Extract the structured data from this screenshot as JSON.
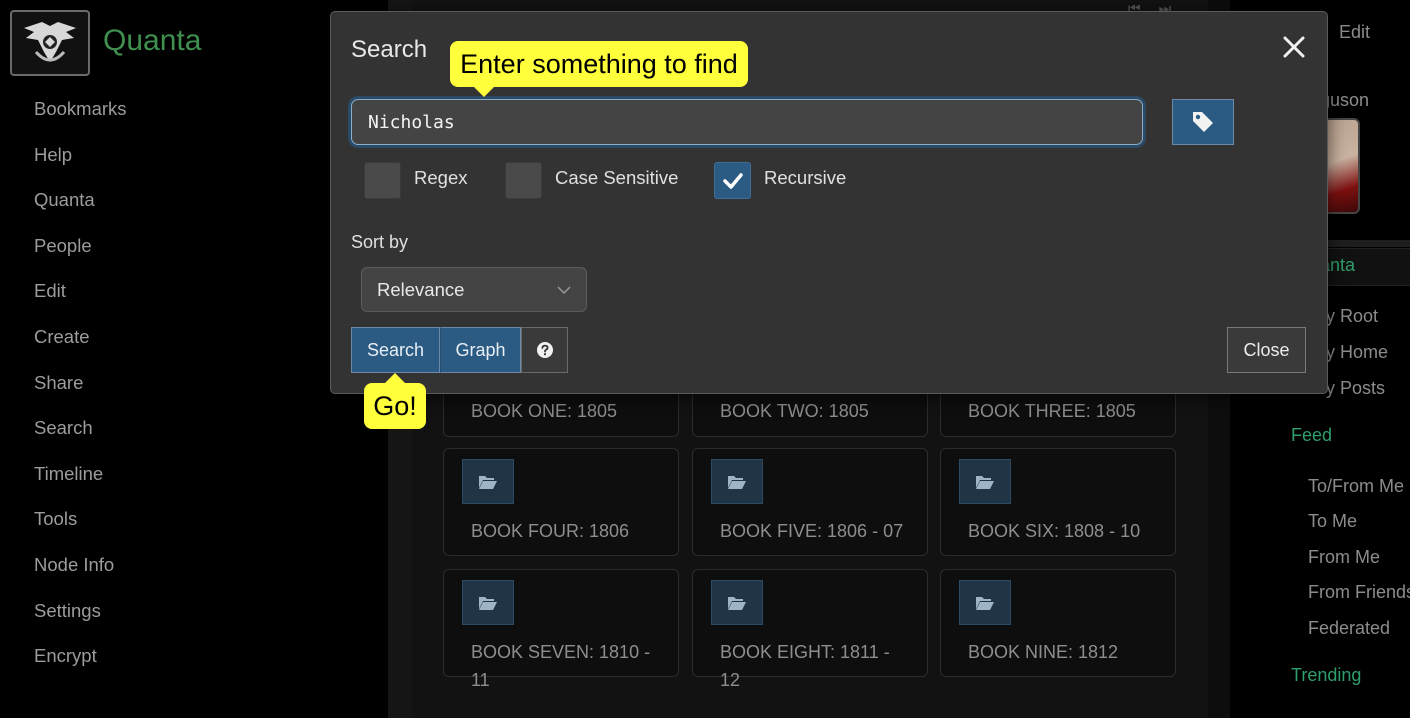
{
  "app": {
    "title": "Quanta"
  },
  "left_menu": [
    "Bookmarks",
    "Help",
    "Quanta",
    "People",
    "Edit",
    "Create",
    "Share",
    "Search",
    "Timeline",
    "Tools",
    "Node Info",
    "Settings",
    "Encrypt"
  ],
  "cards": [
    {
      "label": "BOOK ONE: 1805"
    },
    {
      "label": "BOOK TWO: 1805"
    },
    {
      "label": "BOOK THREE: 1805"
    },
    {
      "label": "BOOK FOUR: 1806"
    },
    {
      "label": "BOOK FIVE: 1806 - 07"
    },
    {
      "label": "BOOK SIX: 1808 - 10"
    },
    {
      "label": "BOOK SEVEN: 1810 - 11"
    },
    {
      "label": "BOOK EIGHT: 1811 - 12"
    },
    {
      "label": "BOOK NINE: 1812"
    }
  ],
  "right_panel": {
    "edit_label": "Edit",
    "user_name_fragment": "guson",
    "quanta_label": "anta",
    "links_top": [
      "y Root",
      "y Home",
      "y Posts"
    ],
    "feed_heading": "Feed",
    "feed_links": [
      "To/From Me",
      "To Me",
      "From Me",
      "From Friends",
      "Federated"
    ],
    "trending_heading": "Trending"
  },
  "modal": {
    "title": "Search",
    "search_value": "Nicholas",
    "options": [
      {
        "label": "Regex",
        "checked": false
      },
      {
        "label": "Case Sensitive",
        "checked": false
      },
      {
        "label": "Recursive",
        "checked": true
      }
    ],
    "sort_label": "Sort by",
    "sort_value": "Relevance",
    "search_button": "Search",
    "graph_button": "Graph",
    "close_button": "Close"
  },
  "tooltips": {
    "find": "Enter something to find",
    "go": "Go!"
  },
  "icons": {
    "logo": "eagle-logo-icon",
    "close": "close-icon",
    "tag": "tag-icon",
    "help": "question-circle-icon",
    "folder": "folder-open-icon",
    "checkmark": "checkmark-icon",
    "chevron": "chevron-down-icon"
  },
  "colors": {
    "accent": "#2b5a82",
    "brand_green": "#3f8f4f",
    "tooltip": "#ffff3c",
    "modal_bg": "#333333"
  }
}
